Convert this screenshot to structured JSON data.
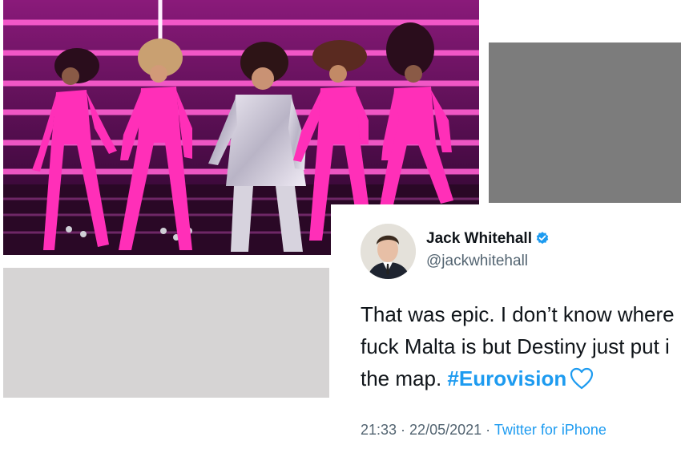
{
  "photo": {
    "description_icon": "stage-performance-photo"
  },
  "tweet": {
    "author_name": "Jack Whitehall",
    "author_handle": "@jackwhitehall",
    "verified_icon": "verified-badge-icon",
    "text_line1": "That was epic. I don’t know where",
    "text_line2": "fuck Malta is but Destiny just put i",
    "text_line3_prefix": "the map. ",
    "hashtag": "#Eurovision",
    "heart_icon": "blue-heart-icon",
    "time": "21:33",
    "separator": " · ",
    "date": "22/05/2021",
    "source": "Twitter for iPhone"
  },
  "colors": {
    "link": "#1d9bf0",
    "stage_pink": "#ff2fb8",
    "placeholder_dark": "#7c7c7c",
    "placeholder_light": "#d6d4d4"
  }
}
